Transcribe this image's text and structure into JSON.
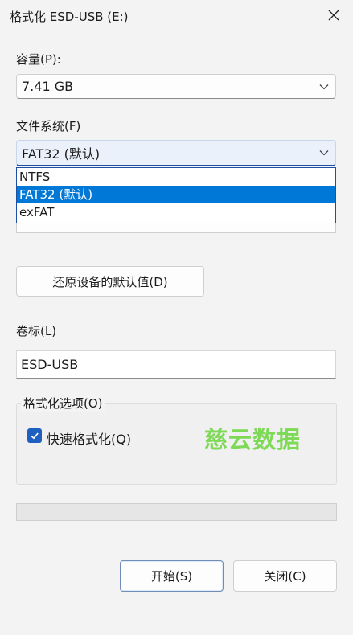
{
  "window": {
    "title": "格式化 ESD-USB (E:)"
  },
  "capacity": {
    "label": "容量(P):",
    "value": "7.41 GB"
  },
  "filesystem": {
    "label": "文件系统(F)",
    "value": "FAT32 (默认)",
    "options": [
      "NTFS",
      "FAT32 (默认)",
      "exFAT"
    ],
    "selected_index": 1
  },
  "restore_button": {
    "label": "还原设备的默认值(D)"
  },
  "volume": {
    "label": "卷标(L)",
    "value": "ESD-USB"
  },
  "format_options": {
    "label": "格式化选项(O)",
    "quick_format": {
      "label": "快速格式化(Q)",
      "checked": true
    }
  },
  "watermark": {
    "text": "慈云数据"
  },
  "progress": {
    "fraction": 0
  },
  "buttons": {
    "start": "开始(S)",
    "close": "关闭(C)"
  },
  "colors": {
    "accent": "#0078d7",
    "checkbox": "#1f5fbf",
    "watermark": "#7ed957"
  },
  "icons": {
    "close": "close-icon",
    "dropdown": "chevron-down-icon",
    "check": "checkmark-icon"
  }
}
